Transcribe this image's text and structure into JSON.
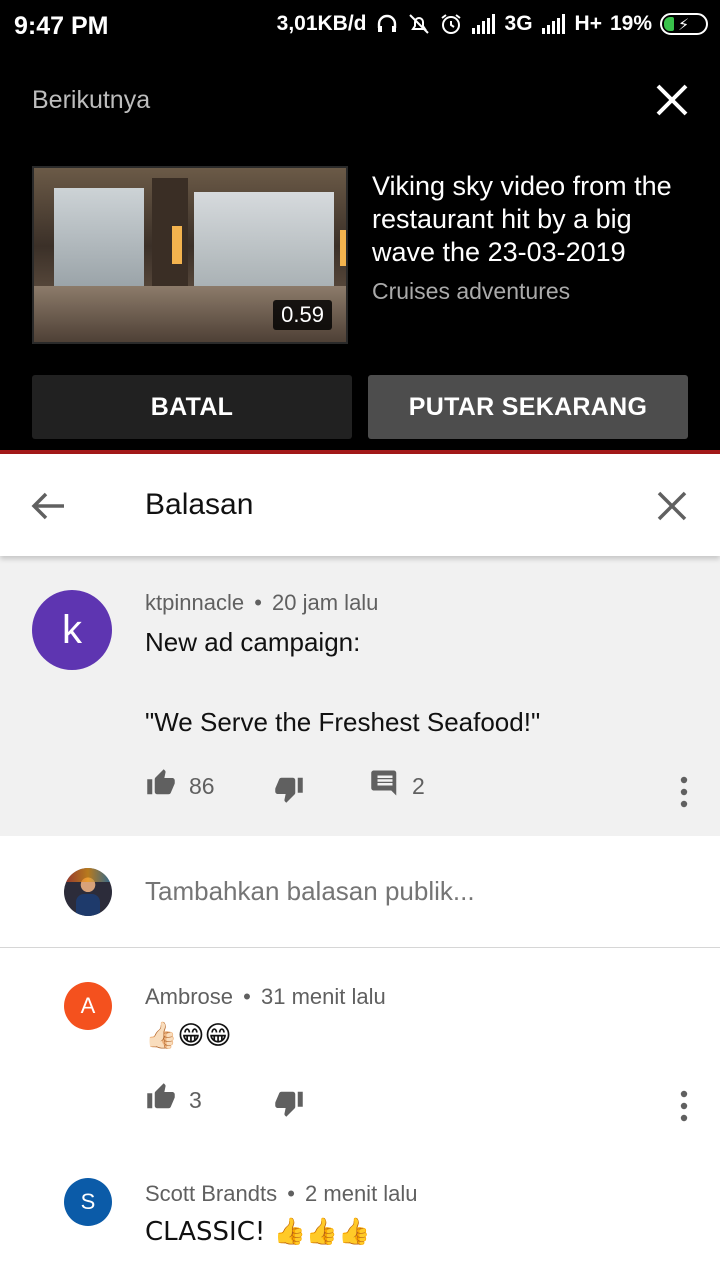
{
  "status_bar": {
    "time": "9:47 PM",
    "speed": "3,01KB/d",
    "network1": "3G",
    "network2": "H+",
    "battery": "19%",
    "icons": [
      "headset-icon",
      "bell-off-icon",
      "alarm-icon",
      "signal-icon",
      "battery-charging-icon"
    ]
  },
  "up_next": {
    "label": "Berikutnya",
    "video_title": "Viking sky video from the restaurant hit by a big wave the 23-03-2019",
    "channel": "Cruises adventures",
    "duration": "0.59",
    "cancel_label": "BATAL",
    "play_label": "PUTAR SEKARANG"
  },
  "header": {
    "title": "Balasan"
  },
  "main_comment": {
    "avatar_letter": "k",
    "avatar_color": "#5e35b1",
    "author": "ktpinnacle",
    "time": "20 jam lalu",
    "text": "New ad campaign:\n\n\"We Serve the Freshest Seafood!\"",
    "likes": "86",
    "replies": "2"
  },
  "reply_input": {
    "placeholder": "Tambahkan balasan publik..."
  },
  "replies": [
    {
      "avatar_letter": "A",
      "avatar_color": "#f4511e",
      "author": "Ambrose",
      "time": "31 menit lalu",
      "text": "👍🏻😁😁",
      "likes": "3"
    },
    {
      "avatar_letter": "S",
      "avatar_color": "#0b5ba8",
      "author": "Scott Brandts",
      "time": "2 menit lalu",
      "text": "CLASSIC! 👍👍👍"
    }
  ],
  "separator": "•",
  "colors": {
    "accent_red": "#a31919",
    "background_dark": "#000000",
    "comment_bg": "#f1f1f1"
  }
}
